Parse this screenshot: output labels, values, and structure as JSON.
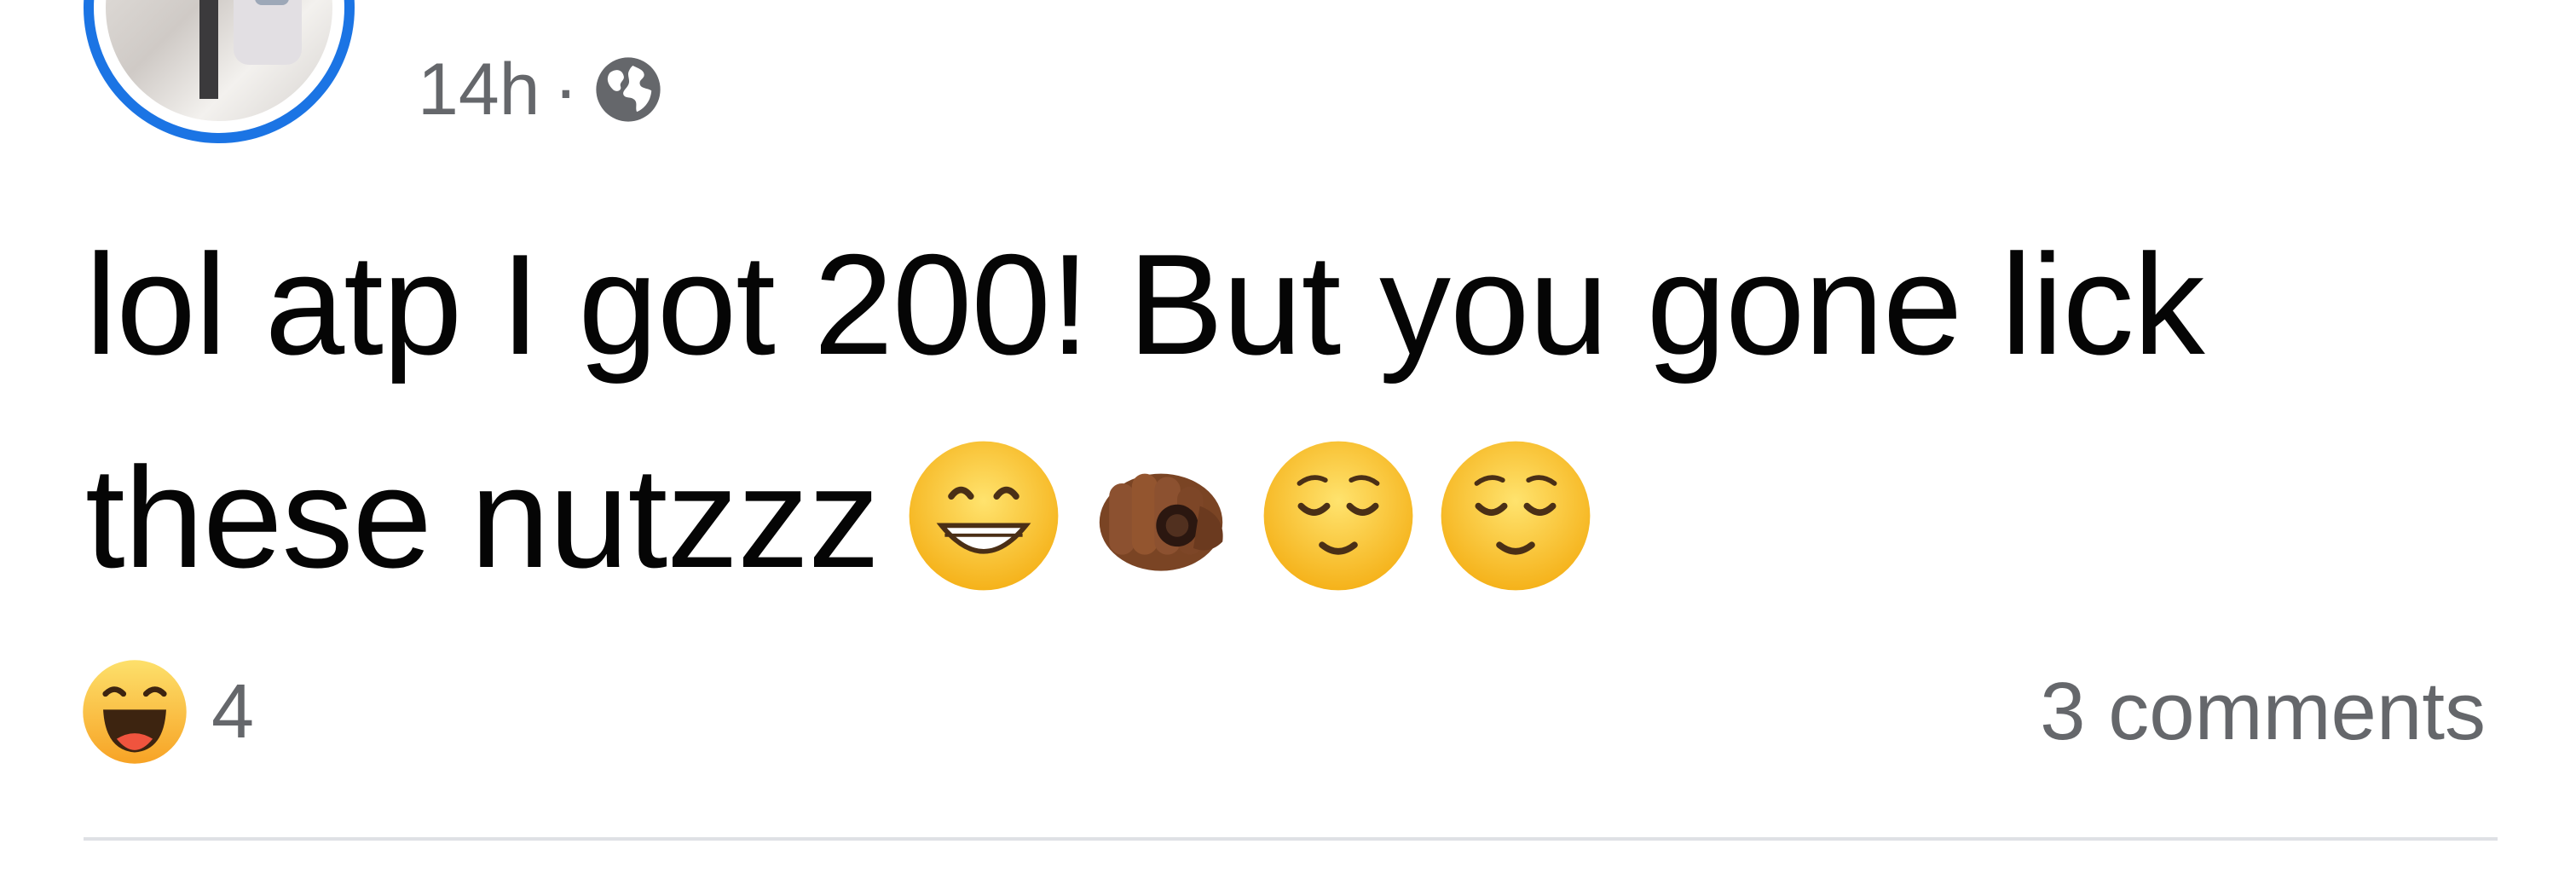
{
  "post": {
    "timestamp": "14h",
    "separator": "·",
    "privacy_icon": "globe-icon",
    "text_line1": "lol atp I got 200! But you gone lick",
    "text_line2": "these nutzzz",
    "emojis": [
      "grinning-face-with-smiling-eyes",
      "backhand-index-pointing-at-viewer-dark-skin",
      "relieved-face",
      "relieved-face"
    ]
  },
  "footer": {
    "reaction_icon": "haha-reaction-icon",
    "reaction_count": "4",
    "comments_label": "3 comments"
  },
  "colors": {
    "avatar_ring": "#1b74e4",
    "meta_text": "#65676b",
    "body_text": "#050505",
    "divider": "#dfe1e5"
  }
}
